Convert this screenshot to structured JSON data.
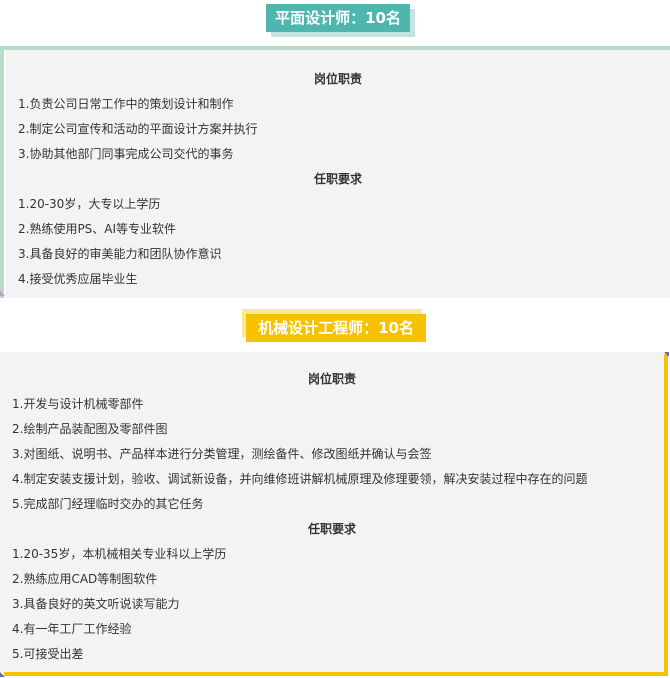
{
  "sections": [
    {
      "title": "平面设计师：10名",
      "duties_heading": "岗位职责",
      "duties": [
        "1.负责公司日常工作中的策划设计和制作",
        "2.制定公司宣传和活动的平面设计方案并执行",
        "3.协助其他部门同事完成公司交代的事务"
      ],
      "requirements_heading": "任职要求",
      "requirements": [
        "1.20-30岁，大专以上学历",
        "2.熟练使用PS、AI等专业软件",
        "3.具备良好的审美能力和团队协作意识",
        "4.接受优秀应届毕业生"
      ],
      "accent_color": "#4fb6ad"
    },
    {
      "title": "机械设计工程师：10名",
      "duties_heading": "岗位职责",
      "duties": [
        "1.开发与设计机械零部件",
        "2.绘制产品装配图及零部件图",
        "3.对图纸、说明书、产品样本进行分类管理，测绘备件、修改图纸并确认与会签",
        "4.制定安装支援计划，验收、调试新设备，并向维修班讲解机械原理及修理要领，解决安装过程中存在的问题",
        "5.完成部门经理临时交办的其它任务"
      ],
      "requirements_heading": "任职要求",
      "requirements": [
        "1.20-35岁，本机械相关专业科以上学历",
        "2.熟练应用CAD等制图软件",
        "3.具备良好的英文听说读写能力",
        "4.有一年工厂工作经验",
        "5.可接受出差"
      ],
      "accent_color": "#f6c200"
    }
  ]
}
